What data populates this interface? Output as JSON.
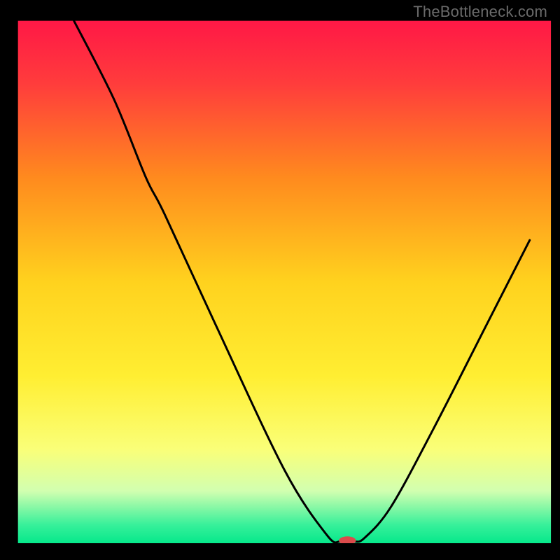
{
  "watermark": "TheBottleneck.com",
  "chart_data": {
    "type": "line",
    "title": "",
    "xlabel": "",
    "ylabel": "",
    "xlim": [
      0,
      100
    ],
    "ylim": [
      0,
      100
    ],
    "background_gradient": {
      "stops": [
        {
          "offset": 0.0,
          "color": "#ff1846"
        },
        {
          "offset": 0.12,
          "color": "#ff3c3c"
        },
        {
          "offset": 0.3,
          "color": "#ff8a1e"
        },
        {
          "offset": 0.5,
          "color": "#ffd21e"
        },
        {
          "offset": 0.68,
          "color": "#ffee32"
        },
        {
          "offset": 0.82,
          "color": "#faff78"
        },
        {
          "offset": 0.9,
          "color": "#d2ffb0"
        },
        {
          "offset": 0.965,
          "color": "#37f09a"
        },
        {
          "offset": 1.0,
          "color": "#06e88b"
        }
      ]
    },
    "series": [
      {
        "name": "bottleneck-curve",
        "x": [
          10.5,
          18.0,
          24.0,
          27.5,
          37.0,
          50.0,
          58.0,
          60.5,
          63.0,
          65.0,
          70.0,
          78.0,
          88.0,
          96.0
        ],
        "y": [
          100.0,
          85.0,
          70.0,
          63.0,
          42.0,
          14.0,
          1.5,
          0.3,
          0.3,
          1.0,
          7.0,
          22.0,
          42.0,
          58.0
        ]
      }
    ],
    "marker": {
      "x": 61.8,
      "y": 0.5,
      "color": "#db4b4b",
      "rx": 1.6,
      "ry": 0.8
    },
    "frame": {
      "left_pct": 3.2,
      "right_pct": 98.4,
      "top_pct": 3.7,
      "bottom_pct": 97.0
    }
  }
}
